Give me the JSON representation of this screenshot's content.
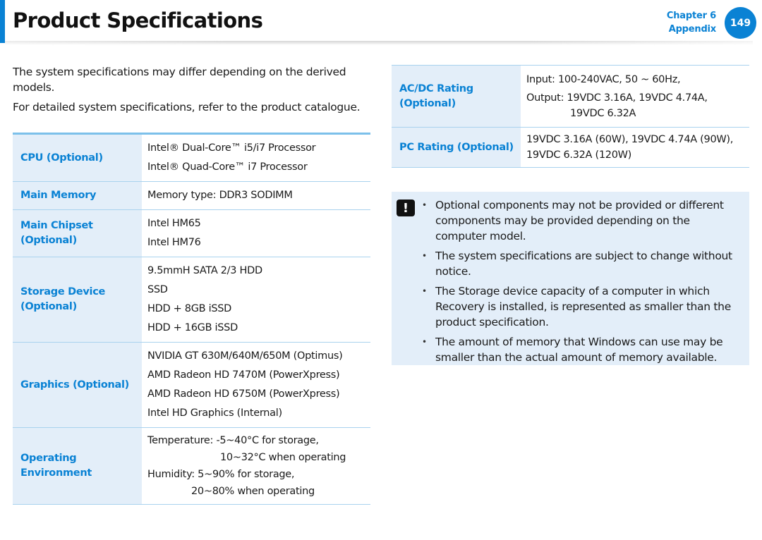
{
  "header": {
    "title": "Product Specifications",
    "chapter": "Chapter 6",
    "section": "Appendix",
    "page_number": "149",
    "accent_color": "#0a82d4"
  },
  "intro": [
    "The system specifications may differ depending on the derived models.",
    "For detailed system specifications, refer to the product catalogue."
  ],
  "left_table": [
    {
      "label": "CPU (Optional)",
      "values": [
        "Intel® Dual-Core™ i5/i7 Processor",
        "Intel® Quad-Core™ i7 Processor"
      ]
    },
    {
      "label": "Main Memory",
      "values": [
        "Memory type: DDR3 SODIMM"
      ]
    },
    {
      "label": "Main Chipset (Optional)",
      "values": [
        "Intel HM65",
        "Intel HM76"
      ]
    },
    {
      "label": "Storage Device (Optional)",
      "values": [
        "9.5mmH SATA 2/3 HDD",
        "SSD",
        "HDD + 8GB iSSD",
        "HDD + 16GB iSSD"
      ]
    },
    {
      "label": "Graphics (Optional)",
      "values": [
        "NVIDIA GT 630M/640M/650M (Optimus)",
        "AMD Radeon HD 7470M (PowerXpress)",
        "AMD Radeon HD 6750M (PowerXpress)",
        "Intel HD Graphics (Internal)"
      ]
    },
    {
      "label": "Operating Environment",
      "values": [
        "Temperature: -5~40°C for storage,",
        "10~32°C when operating",
        "Humidity: 5~90% for storage,",
        "20~80% when operating"
      ]
    }
  ],
  "right_table": [
    {
      "label": "AC/DC Rating (Optional)",
      "values": [
        "Input: 100-240VAC, 50 ~ 60Hz,",
        "Output: 19VDC 3.16A, 19VDC 4.74A,",
        "19VDC 6.32A"
      ]
    },
    {
      "label": "PC Rating (Optional)",
      "values": [
        "19VDC 3.16A (60W), 19VDC 4.74A (90W),",
        "19VDC 6.32A (120W)"
      ]
    }
  ],
  "note": {
    "icon": "caution-icon",
    "items": [
      "Optional components may not be provided or different components may be provided depending on the computer model.",
      "The system specifications are subject to change without notice.",
      "The Storage device capacity of a computer in which Recovery is installed, is represented as smaller than the product specification.",
      "The amount of memory that Windows can use may be smaller than the actual amount of memory available."
    ]
  }
}
